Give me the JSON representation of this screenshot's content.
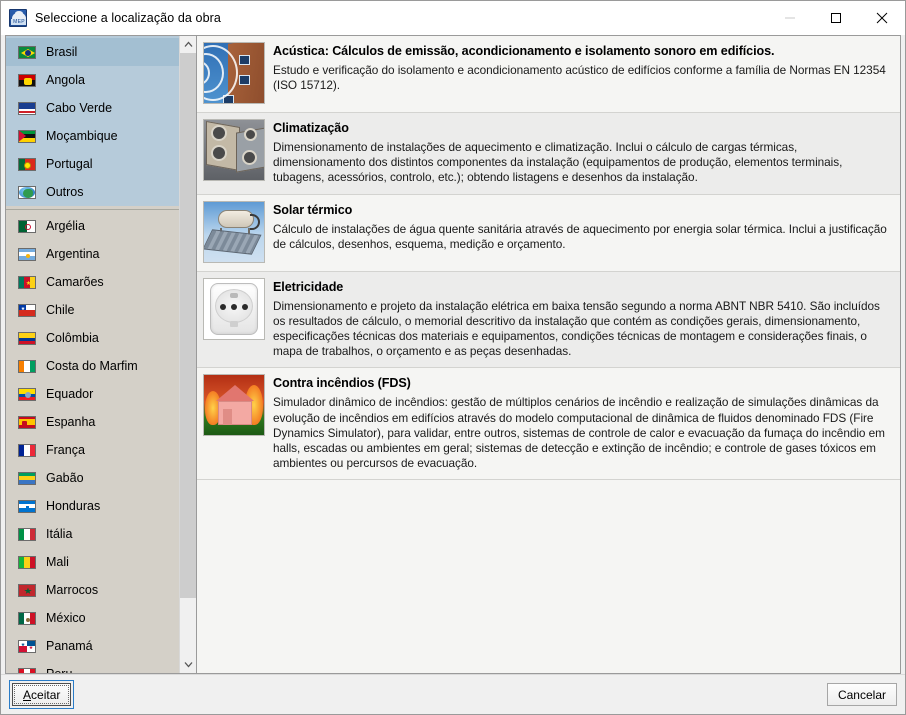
{
  "window": {
    "title": "Seleccione a localização da obra",
    "app_icon": "mep-cloud-icon",
    "icon_label": "MEP",
    "controls": {
      "minimize": "minimize-icon",
      "maximize": "maximize-icon",
      "close": "close-icon"
    }
  },
  "sidebar": {
    "primary_group": [
      {
        "label": "Brasil",
        "flag": "flag-brasil",
        "selected": true
      },
      {
        "label": "Angola",
        "flag": "flag-angola",
        "selected": false
      },
      {
        "label": "Cabo Verde",
        "flag": "flag-cabo-verde",
        "selected": false
      },
      {
        "label": "Moçambique",
        "flag": "flag-mocambique",
        "selected": false
      },
      {
        "label": "Portugal",
        "flag": "flag-portugal",
        "selected": false
      },
      {
        "label": "Outros",
        "flag": "globe-icon",
        "selected": false
      }
    ],
    "secondary_group": [
      {
        "label": "Argélia",
        "flag": "flag-argelia"
      },
      {
        "label": "Argentina",
        "flag": "flag-argentina"
      },
      {
        "label": "Camarões",
        "flag": "flag-camaroes"
      },
      {
        "label": "Chile",
        "flag": "flag-chile"
      },
      {
        "label": "Colômbia",
        "flag": "flag-colombia"
      },
      {
        "label": "Costa do Marfim",
        "flag": "flag-costa-do-marfim"
      },
      {
        "label": "Equador",
        "flag": "flag-equador"
      },
      {
        "label": "Espanha",
        "flag": "flag-espanha"
      },
      {
        "label": "França",
        "flag": "flag-franca"
      },
      {
        "label": "Gabão",
        "flag": "flag-gabao"
      },
      {
        "label": "Honduras",
        "flag": "flag-honduras"
      },
      {
        "label": "Itália",
        "flag": "flag-italia"
      },
      {
        "label": "Mali",
        "flag": "flag-mali"
      },
      {
        "label": "Marrocos",
        "flag": "flag-marrocos"
      },
      {
        "label": "México",
        "flag": "flag-mexico"
      },
      {
        "label": "Panamá",
        "flag": "flag-panama"
      },
      {
        "label": "Peru",
        "flag": "flag-peru"
      }
    ]
  },
  "modules": [
    {
      "icon": "acoustic-building-icon",
      "title": "Acústica: Cálculos de emissão, acondicionamento e isolamento sonoro em edifícios.",
      "description": "Estudo e verificação do isolamento e acondicionamento acústico de edifícios conforme a família de Normas EN 12354 (ISO 15712)."
    },
    {
      "icon": "hvac-units-icon",
      "title": "Climatização",
      "description": "Dimensionamento de instalações de aquecimento e climatização. Inclui o cálculo de cargas térmicas, dimensionamento dos distintos componentes da instalação (equipamentos de produção, elementos terminais, tubagens, acessórios, controlo, etc.); obtendo listagens e desenhos da instalação."
    },
    {
      "icon": "solar-thermal-icon",
      "title": "Solar térmico",
      "description": "Cálculo de instalações de água quente sanitária através de aquecimento por energia solar térmica. Inclui a justificação de cálculos, desenhos, esquema, medição e orçamento."
    },
    {
      "icon": "electrical-socket-icon",
      "title": "Eletricidade",
      "description": "Dimensionamento e projeto da instalação elétrica em baixa tensão segundo a norma ABNT NBR 5410. São incluídos os resultados de cálculo, o memorial descritivo da instalação que contém as condições gerais, dimensionamento, especificações técnicas dos materiais e equipamentos, condições técnicas de montagem e considerações finais, o mapa de trabalhos, o orçamento e as peças desenhadas."
    },
    {
      "icon": "burning-house-icon",
      "title": "Contra incêndios (FDS)",
      "description": "Simulador dinâmico de incêndios: gestão de múltiplos cenários de incêndio e realização de simulações dinâmicas da evolução de incêndios em edifícios através do modelo computacional de dinâmica de fluidos denominado FDS (Fire Dynamics Simulator), para validar, entre outros, sistemas de controle de calor e evacuação da fumaça do incêndio em halls, escadas ou ambientes em geral; sistemas de detecção e extinção de incêndio; e controle de gases tóxicos em ambientes ou percursos de evacuação."
    }
  ],
  "footer": {
    "accept_accel": "A",
    "accept_rest": "ceitar",
    "cancel_label": "Cancelar"
  },
  "colors": {
    "primary_group_bg": "#b6cbda",
    "selected_bg": "#a3bfd2",
    "secondary_group_bg": "#d4d0c8",
    "row_odd": "#f5f5f3",
    "row_even": "#ececeb",
    "focus_ring": "#2a7cc7"
  }
}
